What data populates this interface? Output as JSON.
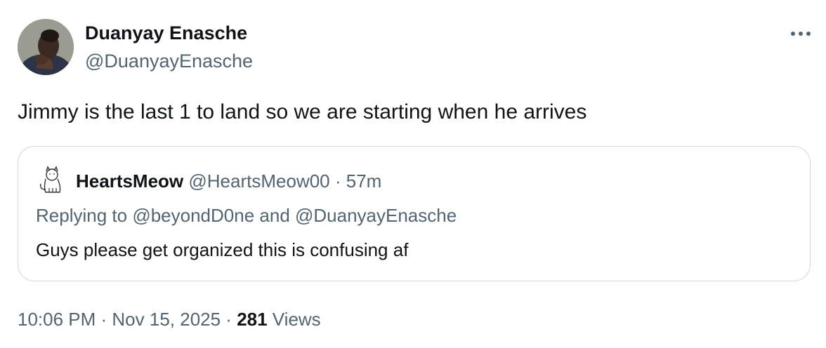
{
  "author": {
    "display_name": "Duanyay Enasche",
    "handle": "@DuanyayEnasche",
    "avatar_icon": "user-photo-avatar"
  },
  "more_icon": "more-horizontal-icon",
  "tweet": {
    "text": "Jimmy is the last 1 to land so we are starting when he arrives"
  },
  "quote": {
    "avatar_icon": "cat-avatar-icon",
    "display_name": "HeartsMeow",
    "handle": "@HeartsMeow00",
    "separator": " · ",
    "time": "57m",
    "replying_prefix": "Replying to ",
    "replying_user_1": "@beyondD0ne",
    "replying_and": " and ",
    "replying_user_2": "@DuanyayEnasche",
    "text": "Guys please get organized this is confusing af"
  },
  "meta": {
    "time": "10:06 PM",
    "sep1": " · ",
    "date": "Nov 15, 2025",
    "sep2": " · ",
    "views_count": "281",
    "views_label": " Views"
  },
  "colors": {
    "text_primary": "#0f1419",
    "text_secondary": "#536471",
    "border": "#cfd9de"
  }
}
